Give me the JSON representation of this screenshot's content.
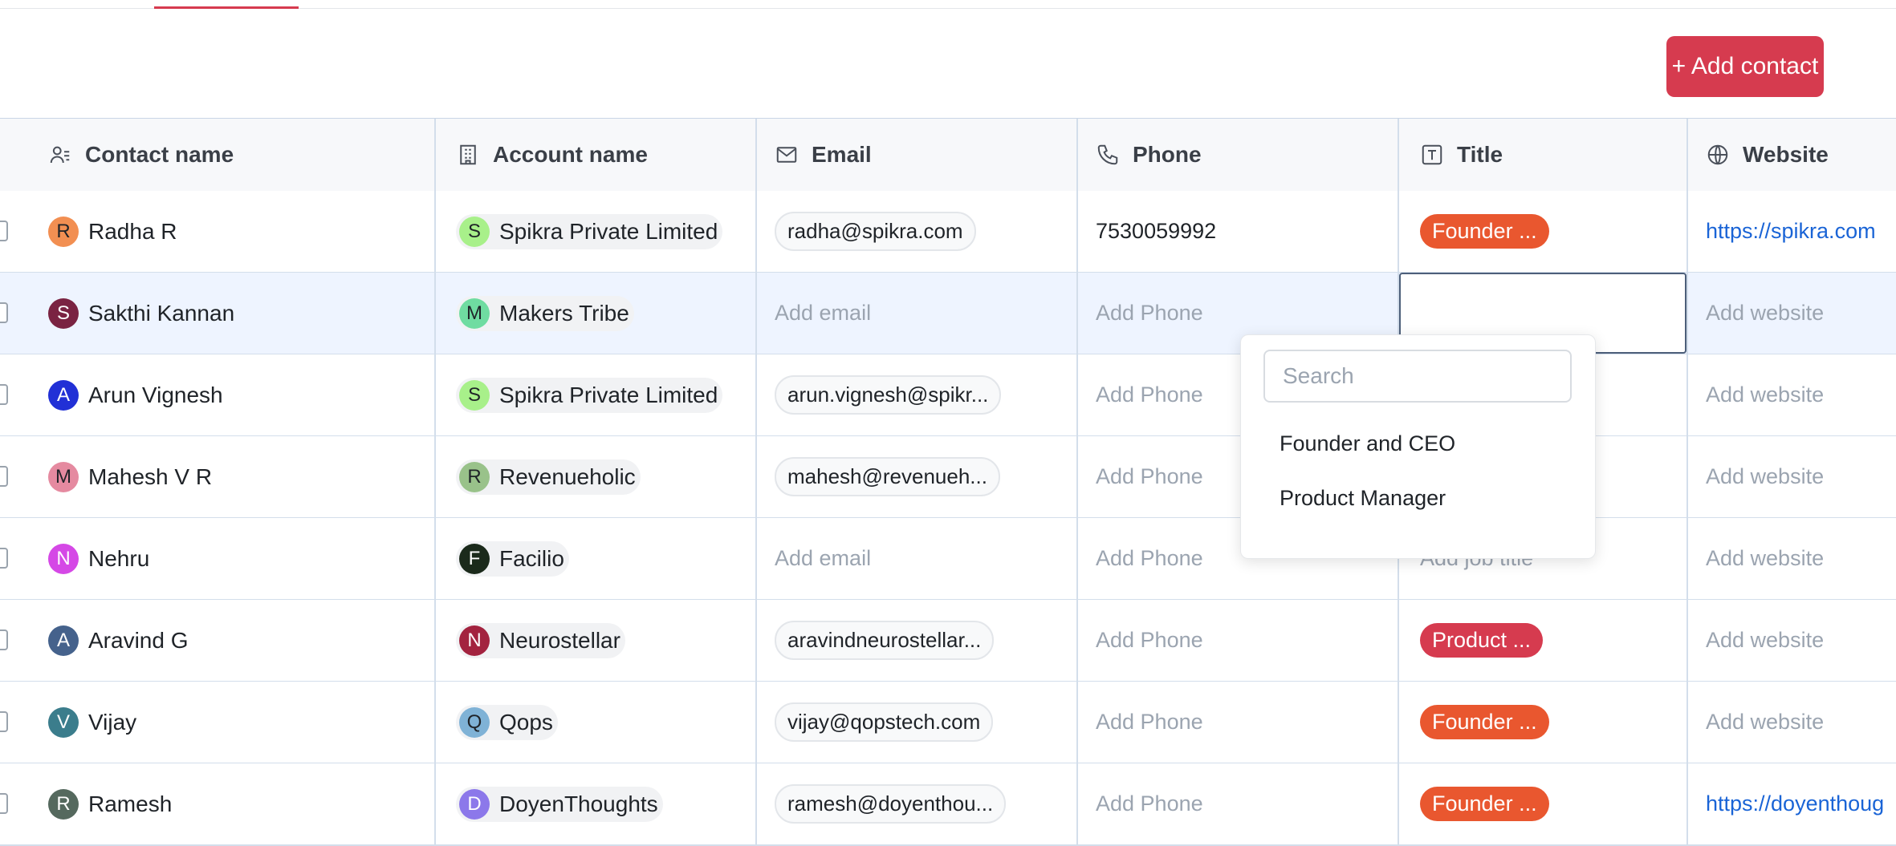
{
  "header": {
    "add_contact_label": "+ Add contact"
  },
  "columns": [
    {
      "label": "Contact name",
      "icon": "contact-list-icon"
    },
    {
      "label": "Account name",
      "icon": "building-icon"
    },
    {
      "label": "Email",
      "icon": "mail-icon"
    },
    {
      "label": "Phone",
      "icon": "phone-icon"
    },
    {
      "label": "Title",
      "icon": "title-text-icon"
    },
    {
      "label": "Website",
      "icon": "globe-icon"
    }
  ],
  "rows": [
    {
      "initial": "R",
      "name": "Radha R",
      "avatar_color": "#f28f52",
      "account_initial": "S",
      "account": "Spikra Private Limited",
      "account_color": "#a8f08a",
      "email": "radha@spikra.com",
      "phone": "7530059992",
      "title": "Founder ...",
      "website": "https://spikra.com"
    },
    {
      "initial": "S",
      "name": "Sakthi Kannan",
      "avatar_color": "#7a2342",
      "account_initial": "M",
      "account": "Makers Tribe",
      "account_color": "#6fdca1",
      "email": "Add email",
      "phone": "Add Phone",
      "title": "",
      "website": "Add website"
    },
    {
      "initial": "A",
      "name": "Arun Vignesh",
      "avatar_color": "#2130d6",
      "account_initial": "S",
      "account": "Spikra Private Limited",
      "account_color": "#a8f08a",
      "email": "arun.vignesh@spikr...",
      "phone": "Add Phone",
      "title": "",
      "website": "Add website"
    },
    {
      "initial": "M",
      "name": "Mahesh V R",
      "avatar_color": "#e58aa0",
      "account_initial": "R",
      "account": "Revenueholic",
      "account_color": "#99c28a",
      "email": "mahesh@revenueh...",
      "phone": "Add Phone",
      "title": "",
      "website": "Add website"
    },
    {
      "initial": "N",
      "name": "Nehru",
      "avatar_color": "#d548e6",
      "account_initial": "F",
      "account": "Facilio",
      "account_color": "#1b2a1b",
      "email": "Add email",
      "phone": "Add Phone",
      "title": "Add job title",
      "website": "Add website"
    },
    {
      "initial": "A",
      "name": "Aravind G",
      "avatar_color": "#45628c",
      "account_initial": "N",
      "account": "Neurostellar",
      "account_color": "#a3233f",
      "email": "aravindneurostellar...",
      "phone": "Add Phone",
      "title": "Product ...",
      "website": "Add website"
    },
    {
      "initial": "V",
      "name": "Vijay",
      "avatar_color": "#3b7d8c",
      "account_initial": "Q",
      "account": "Qops",
      "account_color": "#7fb2d6",
      "email": "vijay@qopstech.com",
      "phone": "Add Phone",
      "title": "Founder ...",
      "website": "Add website"
    },
    {
      "initial": "R",
      "name": "Ramesh",
      "avatar_color": "#55695e",
      "account_initial": "D",
      "account": "DoyenThoughts",
      "account_color": "#8c78ea",
      "email": "ramesh@doyenthou...",
      "phone": "Add Phone",
      "title": "Founder ...",
      "website": "https://doyenthoug"
    }
  ],
  "dropdown": {
    "search_placeholder": "Search",
    "options": [
      "Founder and CEO",
      "Product Manager"
    ]
  },
  "colors": {
    "accent": "#d63b4f",
    "badge": "#e9572f",
    "link": "#1a64d6"
  }
}
